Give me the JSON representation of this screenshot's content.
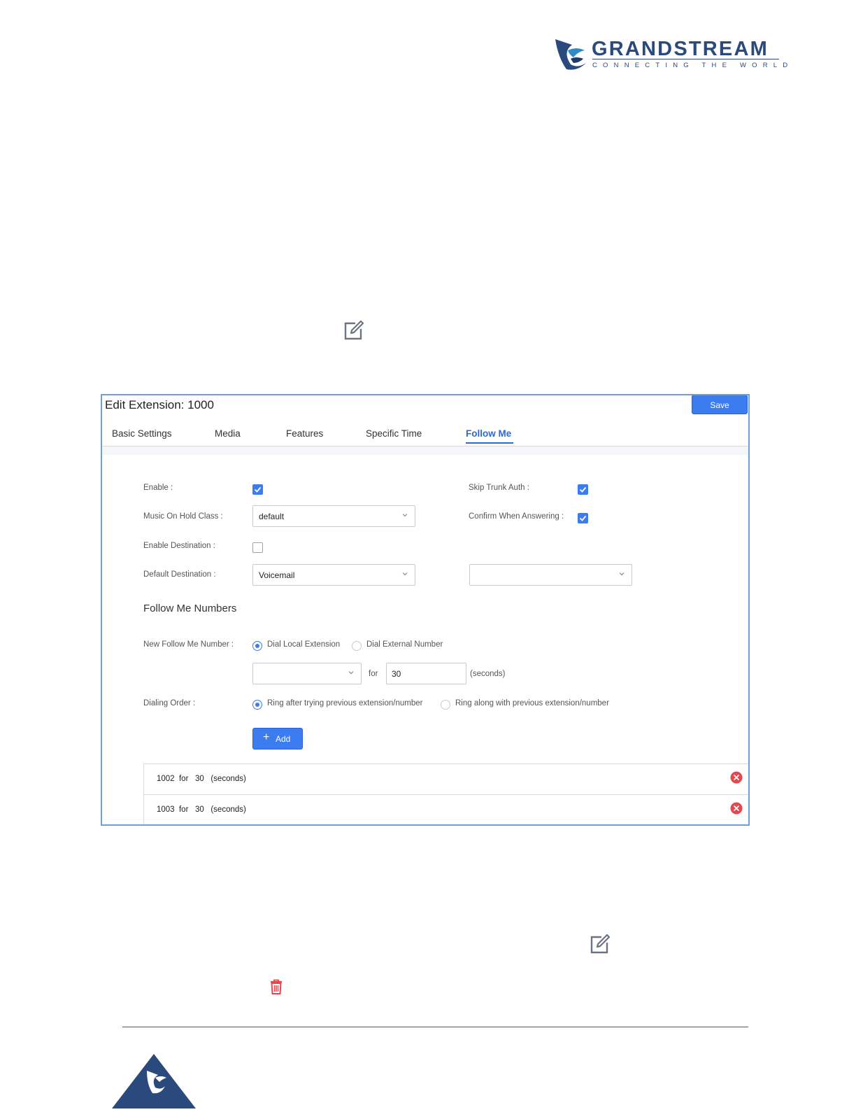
{
  "brand": {
    "name": "GRANDSTREAM",
    "tagline": "CONNECTING THE WORLD"
  },
  "icons": {
    "edit": "edit-icon",
    "delete": "trash-icon",
    "remove": "remove-circle-icon"
  },
  "dialog": {
    "title": "Edit Extension: 1000",
    "save_label": "Save",
    "tabs": [
      {
        "label": "Basic Settings",
        "active": false
      },
      {
        "label": "Media",
        "active": false
      },
      {
        "label": "Features",
        "active": false
      },
      {
        "label": "Specific Time",
        "active": false
      },
      {
        "label": "Follow Me",
        "active": true
      }
    ],
    "form": {
      "enable_label": "Enable :",
      "enable_checked": true,
      "skip_trunk_auth_label": "Skip Trunk Auth :",
      "skip_trunk_auth_checked": true,
      "moh_label": "Music On Hold Class :",
      "moh_value": "default",
      "confirm_label": "Confirm When Answering :",
      "confirm_checked": true,
      "enable_dest_label": "Enable Destination :",
      "enable_dest_checked": false,
      "default_dest_label": "Default Destination :",
      "default_dest_value": "Voicemail",
      "default_dest_secondary_value": ""
    },
    "follow_me": {
      "section_title": "Follow Me Numbers",
      "new_number_label": "New Follow Me Number :",
      "radio_local": "Dial Local Extension",
      "radio_external": "Dial External Number",
      "selected_mode": "local",
      "extension_value": "",
      "for_label": "for",
      "seconds_value": "30",
      "seconds_unit": "(seconds)",
      "dialing_order_label": "Dialing Order :",
      "order_after": "Ring after trying previous extension/number",
      "order_along": "Ring along with previous extension/number",
      "selected_order": "after",
      "add_label": "Add",
      "entries": [
        {
          "text": "1002  for   30   (seconds)"
        },
        {
          "text": "1003  for   30   (seconds)"
        }
      ]
    }
  },
  "colors": {
    "primary": "#3b7cf0",
    "brand": "#2a4a7e",
    "danger": "#e5474d",
    "panel_border": "#6d9fd8"
  }
}
